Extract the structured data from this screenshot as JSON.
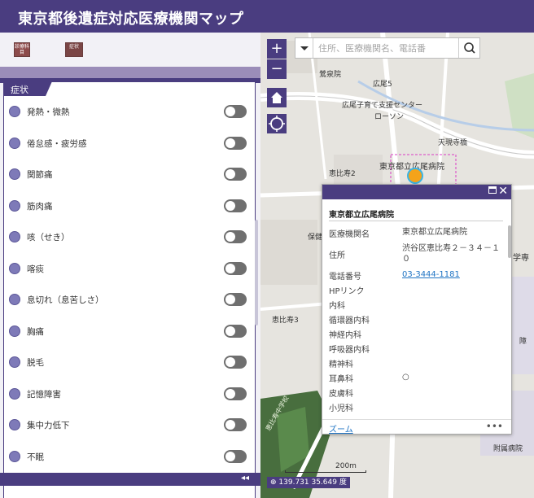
{
  "header": {
    "title": "東京都後遺症対応医療機関マップ"
  },
  "nav": {
    "tab_department": "診療科目",
    "tab_symptom": "症状"
  },
  "symptom_panel": {
    "tab_label": "症状",
    "items": [
      {
        "label": "発熱・微熱"
      },
      {
        "label": "倦怠感・疲労感"
      },
      {
        "label": "関節痛"
      },
      {
        "label": "筋肉痛"
      },
      {
        "label": "咳（せき）"
      },
      {
        "label": "喀痰"
      },
      {
        "label": "息切れ（息苦しさ）"
      },
      {
        "label": "胸痛"
      },
      {
        "label": "脱毛"
      },
      {
        "label": "記憶障害"
      },
      {
        "label": "集中力低下"
      },
      {
        "label": "不眠"
      }
    ],
    "collapse_label": "◂◂"
  },
  "map": {
    "search_placeholder": "住所、医療機関名、電話番",
    "zoom_in": "+",
    "zoom_out": "−",
    "labels": {
      "l1": "鶯泉院",
      "l2": "広尾5",
      "l3": "広尾子育て支援センター",
      "l4": "ローソン",
      "l5": "天現寺橋",
      "l6": "恵比寿2",
      "l7": "東京都立広尾病院",
      "l8": "恵比寿3",
      "l9": "学専",
      "l10": "保健",
      "l11": "障",
      "l12": "附属病院",
      "l13": "恵比寿中学校"
    },
    "scale_label": "200m",
    "coordinates": "139.731 35.649 度"
  },
  "popup": {
    "title": "東京都立広尾病院",
    "attributes": [
      {
        "key": "医療機関名",
        "value": "東京都立広尾病院"
      },
      {
        "key": "住所",
        "value": "渋谷区恵比寿２－３４－１０"
      },
      {
        "key": "電話番号",
        "value": "03-3444-1181"
      },
      {
        "key": "HPリンク",
        "value": ""
      },
      {
        "key": "内科",
        "value": ""
      },
      {
        "key": "循環器内科",
        "value": ""
      },
      {
        "key": "神経内科",
        "value": ""
      },
      {
        "key": "呼吸器内科",
        "value": ""
      },
      {
        "key": "精神科",
        "value": ""
      },
      {
        "key": "耳鼻科",
        "value": "○"
      },
      {
        "key": "皮膚科",
        "value": ""
      },
      {
        "key": "小児科",
        "value": ""
      }
    ],
    "zoom_label": "ズーム",
    "more_label": "•••"
  },
  "colors": {
    "brand": "#4a3d80",
    "bullet": "#7e7ab8",
    "marker": "#f4a31a",
    "link": "#1f74c4"
  }
}
